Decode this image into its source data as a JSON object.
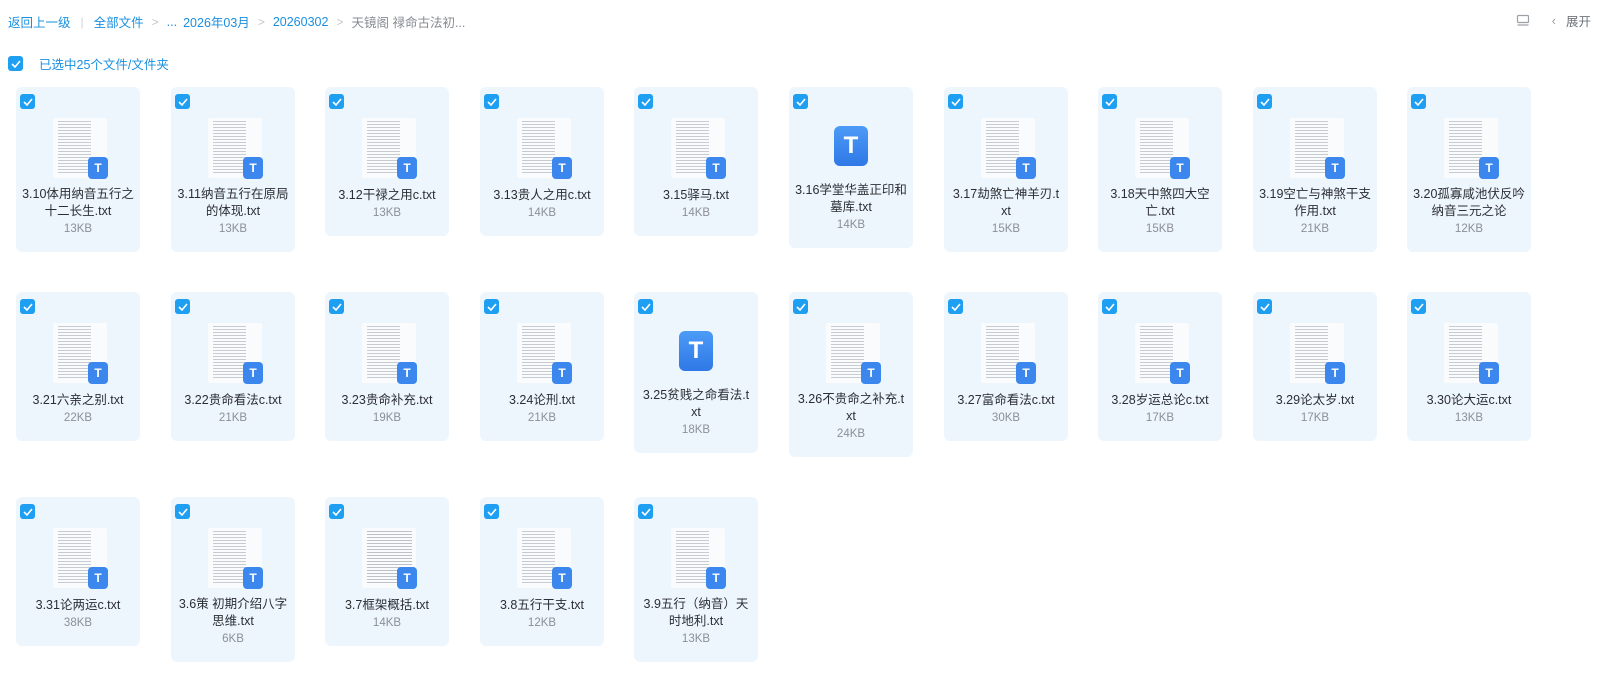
{
  "breadcrumb": {
    "back": "返回上一级",
    "root": "全部文件",
    "ellipsis": "...",
    "month": "2026年03月",
    "day": "20260302",
    "current": "天镜阁 禄命古法初..."
  },
  "toolbar": {
    "expand_label": "展开",
    "list_view_icon": "list-view-icon"
  },
  "selection": {
    "status": "已选中25个文件/文件夹"
  },
  "files": [
    {
      "name": "3.10体用纳音五行之十二长生.txt",
      "size": "13KB",
      "icon": "doc-thumbnail"
    },
    {
      "name": "3.11纳音五行在原局的体现.txt",
      "size": "13KB",
      "icon": "doc-thumbnail"
    },
    {
      "name": "3.12干禄之用c.txt",
      "size": "13KB",
      "icon": "doc-thumbnail"
    },
    {
      "name": "3.13贵人之用c.txt",
      "size": "14KB",
      "icon": "doc-thumbnail"
    },
    {
      "name": "3.15驿马.txt",
      "size": "14KB",
      "icon": "doc-thumbnail"
    },
    {
      "name": "3.16学堂华盖正印和墓库.txt",
      "size": "14KB",
      "icon": "txt-icon"
    },
    {
      "name": "3.17劫煞亡神羊刃.txt",
      "size": "15KB",
      "icon": "doc-thumbnail"
    },
    {
      "name": "3.18天中煞四大空亡.txt",
      "size": "15KB",
      "icon": "doc-thumbnail"
    },
    {
      "name": "3.19空亡与神煞干支作用.txt",
      "size": "21KB",
      "icon": "doc-thumbnail"
    },
    {
      "name": "3.20孤寡咸池伏反吟纳音三元之论",
      "size": "12KB",
      "icon": "doc-thumbnail"
    },
    {
      "name": "3.21六亲之别.txt",
      "size": "22KB",
      "icon": "doc-thumbnail"
    },
    {
      "name": "3.22贵命看法c.txt",
      "size": "21KB",
      "icon": "doc-thumbnail"
    },
    {
      "name": "3.23贵命补充.txt",
      "size": "19KB",
      "icon": "doc-thumbnail"
    },
    {
      "name": "3.24论刑.txt",
      "size": "21KB",
      "icon": "doc-thumbnail"
    },
    {
      "name": "3.25贫贱之命看法.txt",
      "size": "18KB",
      "icon": "txt-icon"
    },
    {
      "name": "3.26不贵命之补充.txt",
      "size": "24KB",
      "icon": "doc-thumbnail"
    },
    {
      "name": "3.27富命看法c.txt",
      "size": "30KB",
      "icon": "doc-thumbnail"
    },
    {
      "name": "3.28岁运总论c.txt",
      "size": "17KB",
      "icon": "doc-thumbnail"
    },
    {
      "name": "3.29论太岁.txt",
      "size": "17KB",
      "icon": "doc-thumbnail"
    },
    {
      "name": "3.30论大运c.txt",
      "size": "13KB",
      "icon": "doc-thumbnail"
    },
    {
      "name": "3.31论两运c.txt",
      "size": "38KB",
      "icon": "doc-thumbnail"
    },
    {
      "name": "3.6策 初期介绍八字思维.txt",
      "size": "6KB",
      "icon": "doc-thumbnail"
    },
    {
      "name": "3.7框架概括.txt",
      "size": "14KB",
      "icon": "doc-thumbnail"
    },
    {
      "name": "3.8五行干支.txt",
      "size": "12KB",
      "icon": "doc-thumbnail"
    },
    {
      "name": "3.9五行（纳音）天时地利.txt",
      "size": "13KB",
      "icon": "doc-thumbnail"
    }
  ],
  "colors": {
    "accent": "#1e9ff2",
    "card_bg": "#eef6fd",
    "txt_badge": "#3b87ee"
  }
}
